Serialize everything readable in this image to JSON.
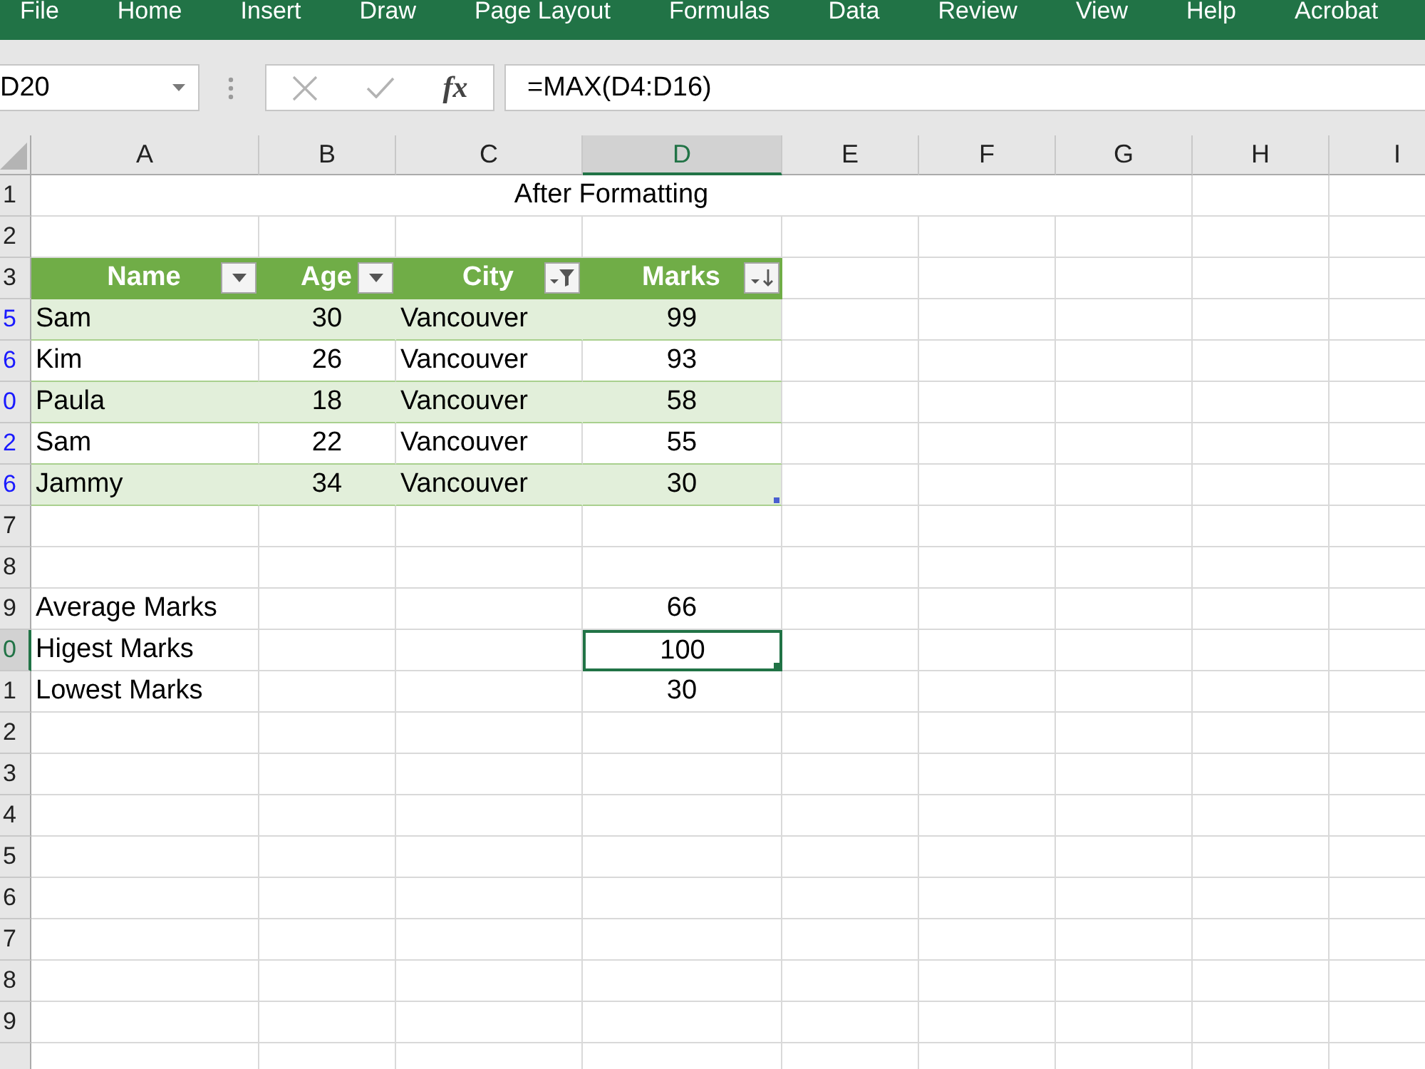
{
  "ribbon_tabs": [
    "File",
    "Home",
    "Insert",
    "Draw",
    "Page Layout",
    "Formulas",
    "Data",
    "Review",
    "View",
    "Help",
    "Acrobat"
  ],
  "formula_bar": {
    "name_box": "D20",
    "buttons": [
      {
        "kind": "cancel",
        "disabled": true
      },
      {
        "kind": "enter",
        "disabled": true
      },
      {
        "kind": "insert_function",
        "label": "fx",
        "disabled": false
      }
    ],
    "formula": "=MAX(D4:D16)"
  },
  "grid": {
    "columns": [
      {
        "label": "A",
        "selected": false
      },
      {
        "label": "B",
        "selected": false
      },
      {
        "label": "C",
        "selected": false
      },
      {
        "label": "D",
        "selected": true
      },
      {
        "label": "E",
        "selected": false
      },
      {
        "label": "F",
        "selected": false
      },
      {
        "label": "G",
        "selected": false
      },
      {
        "label": "H",
        "selected": false
      },
      {
        "label": "I",
        "selected": false
      }
    ],
    "rows": [
      {
        "header": "1",
        "filtered": false,
        "selected": false,
        "kind": "title",
        "text": "After Formatting"
      },
      {
        "header": "2",
        "filtered": false,
        "selected": false,
        "kind": "blank"
      },
      {
        "header": "3",
        "filtered": false,
        "selected": false,
        "kind": "table_header",
        "cells": [
          {
            "label": "Name",
            "kind": "dropdown"
          },
          {
            "label": "Age",
            "kind": "dropdown"
          },
          {
            "label": "City",
            "kind": "filtered"
          },
          {
            "label": "Marks",
            "kind": "sorted_descending"
          }
        ]
      },
      {
        "header": "5",
        "filtered": true,
        "selected": false,
        "kind": "table_row",
        "cells": [
          "Sam",
          "30",
          "Vancouver",
          "99"
        ]
      },
      {
        "header": "6",
        "filtered": true,
        "selected": false,
        "kind": "table_row",
        "cells": [
          "Kim",
          "26",
          "Vancouver",
          "93"
        ]
      },
      {
        "header": "0",
        "filtered": true,
        "selected": false,
        "kind": "table_row",
        "cells": [
          "Paula",
          "18",
          "Vancouver",
          "58"
        ]
      },
      {
        "header": "2",
        "filtered": true,
        "selected": false,
        "kind": "table_row",
        "cells": [
          "Sam",
          "22",
          "Vancouver",
          "55"
        ]
      },
      {
        "header": "6",
        "filtered": true,
        "selected": false,
        "kind": "table_row",
        "cells": [
          "Jammy",
          "34",
          "Vancouver",
          "30"
        ]
      },
      {
        "header": "7",
        "filtered": false,
        "selected": false,
        "kind": "blank"
      },
      {
        "header": "8",
        "filtered": false,
        "selected": false,
        "kind": "blank"
      },
      {
        "header": "9",
        "filtered": false,
        "selected": false,
        "kind": "summary",
        "label": "Average Marks",
        "value": "66"
      },
      {
        "header": "0",
        "filtered": false,
        "selected": true,
        "kind": "summary",
        "label": "Higest Marks",
        "value": "100"
      },
      {
        "header": "1",
        "filtered": false,
        "selected": false,
        "kind": "summary",
        "label": "Lowest Marks",
        "value": "30"
      },
      {
        "header": "2",
        "filtered": false,
        "selected": false,
        "kind": "blank"
      },
      {
        "header": "3",
        "filtered": false,
        "selected": false,
        "kind": "blank"
      },
      {
        "header": "4",
        "filtered": false,
        "selected": false,
        "kind": "blank"
      },
      {
        "header": "5",
        "filtered": false,
        "selected": false,
        "kind": "blank"
      },
      {
        "header": "6",
        "filtered": false,
        "selected": false,
        "kind": "blank"
      },
      {
        "header": "7",
        "filtered": false,
        "selected": false,
        "kind": "blank"
      },
      {
        "header": "8",
        "filtered": false,
        "selected": false,
        "kind": "blank"
      },
      {
        "header": "9",
        "filtered": false,
        "selected": false,
        "kind": "blank"
      }
    ]
  }
}
